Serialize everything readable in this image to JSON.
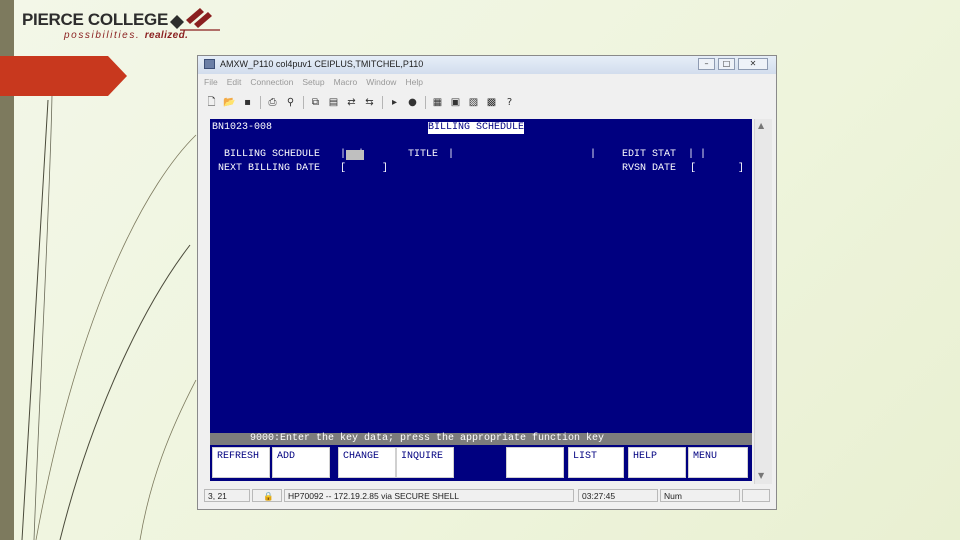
{
  "logo": {
    "name": "PIERCE COLLEGE",
    "tagline": "possibilities.",
    "tagline_bold": "realized."
  },
  "window": {
    "title": "AMXW_P110   col4puv1   CEIPLUS,TMITCHEL,P110",
    "menu": [
      "File",
      "Edit",
      "Connection",
      "Setup",
      "Macro",
      "Window",
      "Help"
    ],
    "toolbar_icons": [
      "new-icon",
      "open-icon",
      "save-icon",
      "print-icon",
      "find-icon",
      "copy-icon",
      "paste-icon",
      "send-icon",
      "disconnect-icon",
      "play-icon",
      "record-icon",
      "keymap-icon",
      "screen-icon",
      "capture-icon",
      "settings-icon",
      "help-icon"
    ]
  },
  "terminal": {
    "screen_id": "BN1023-008",
    "screen_title": "BILLING SCHEDULE",
    "billing_schedule_label": "BILLING SCHEDULE",
    "title_label": "TITLE",
    "edit_stat_label": "EDIT STAT",
    "next_billing_label": "NEXT BILLING DATE",
    "rvsn_label": "RVSN DATE",
    "message": "9000:Enter the key data; press the appropriate function key",
    "fkeys": [
      "REFRESH",
      "ADD",
      "CHANGE",
      "INQUIRE",
      "",
      "",
      "LIST",
      "HELP",
      "MENU"
    ]
  },
  "statusbar": {
    "position": "3, 21",
    "connection": "HP70092 -- 172.19.2.85 via SECURE SHELL",
    "time": "03:27:45",
    "num": "Num"
  },
  "colors": {
    "terminal_bg": "#000080",
    "accent_red": "#c0392b",
    "sidebar": "#7d7a5e"
  }
}
